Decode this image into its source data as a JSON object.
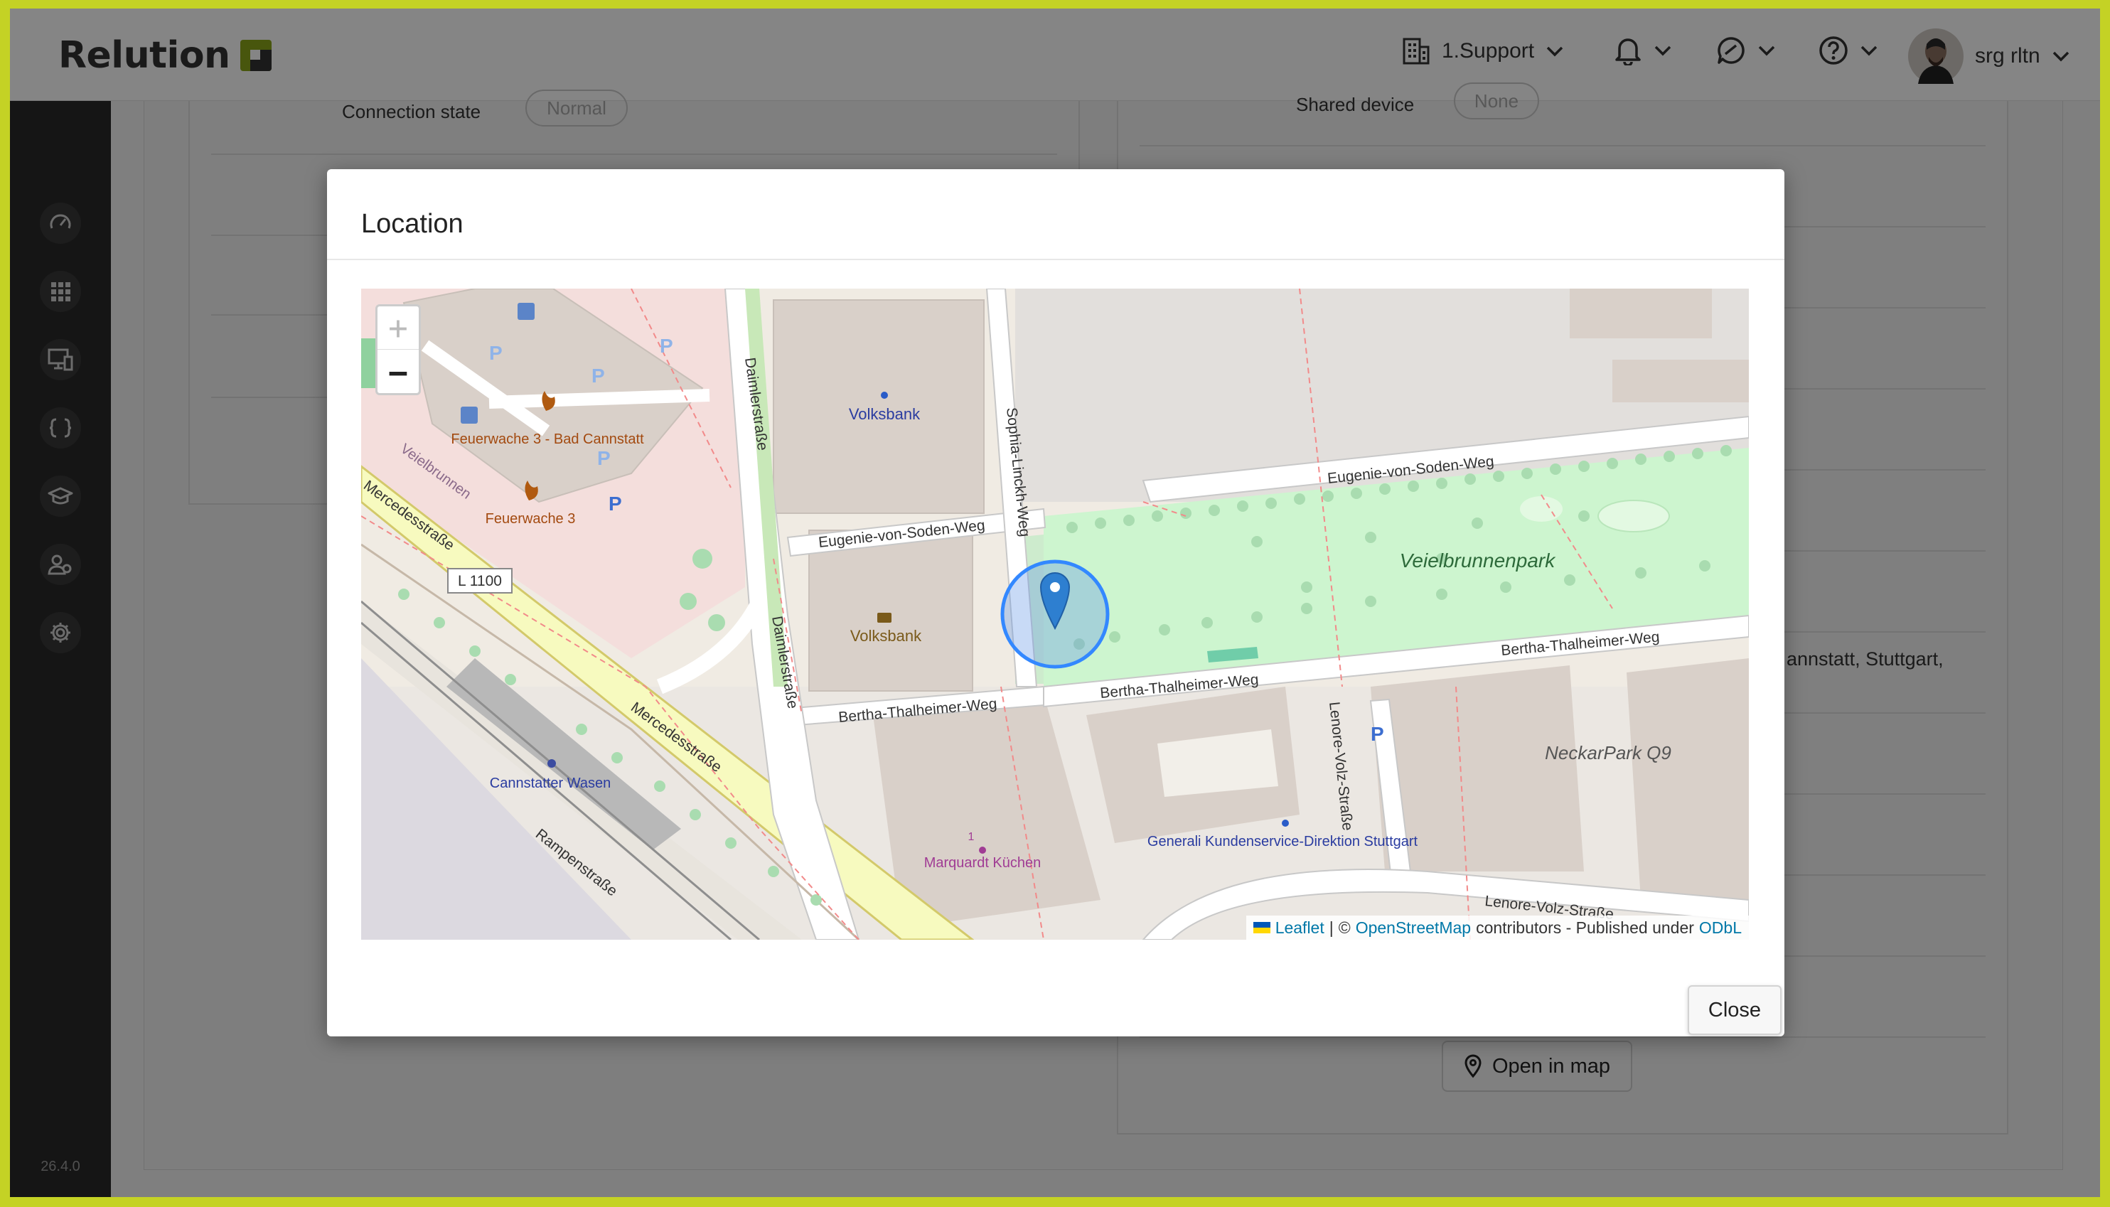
{
  "app": {
    "name": "Relution",
    "version": "26.4.0"
  },
  "header": {
    "org": "1.Support",
    "user": "srg rltn"
  },
  "sidebar": {
    "items": [
      {
        "name": "dashboard-icon"
      },
      {
        "name": "apps-icon"
      },
      {
        "name": "devices-icon"
      },
      {
        "name": "policies-icon"
      },
      {
        "name": "education-icon"
      },
      {
        "name": "users-icon"
      },
      {
        "name": "settings-icon"
      }
    ]
  },
  "background": {
    "connection_state_label": "Connection state",
    "connection_state_value": "Normal",
    "shared_device_label": "Shared device",
    "shared_device_value": "None",
    "address_fragment": "annstatt, Stuttgart,",
    "open_in_map": "Open in map"
  },
  "modal": {
    "title": "Location",
    "close_label": "Close",
    "zoom_in": "+",
    "zoom_out": "−",
    "attribution": {
      "leaflet": "Leaflet",
      "sep": "|",
      "copy": "©",
      "osm": "OpenStreetMap",
      "contrib": "contributors - Published under",
      "odbl": "ODbL"
    },
    "map_labels": {
      "volksbank_top": "Volksbank",
      "volksbank_bottom": "Volksbank",
      "sophia": "Sophia-Linckh-Weg",
      "daimler1": "Daimlerstraße",
      "daimler2": "Daimlerstraße",
      "eugenie_left": "Eugenie-von-Soden-Weg",
      "eugenie_right": "Eugenie-von-Soden-Weg",
      "park": "Veielbrunnenpark",
      "bertha_left": "Bertha-Thalheimer-Weg",
      "bertha_mid": "Bertha-Thalheimer-Weg",
      "bertha_right": "Bertha-Thalheimer-Weg",
      "feuerwache1": "Feuerwache 3 - Bad Cannstatt",
      "feuerwache2": "Feuerwache 3",
      "veielbrunnen_street": "Veielbrunnen",
      "mercedes1": "Mercedesstraße",
      "mercedes2": "Mercedesstraße",
      "l1100": "L 1100",
      "cannstatter": "Cannstatter Wasen",
      "rampen": "Rampenstraße",
      "marquardt": "Marquardt Küchen",
      "marquardt_num": "1",
      "generali": "Generali Kundenservice-Direktion Stuttgart",
      "lenore_volz1": "Lenore-Volz-Straße",
      "lenore_volz2": "Lenore-Volz-Straße",
      "neckarpark": "NeckarPark Q9",
      "parking": "P"
    }
  }
}
